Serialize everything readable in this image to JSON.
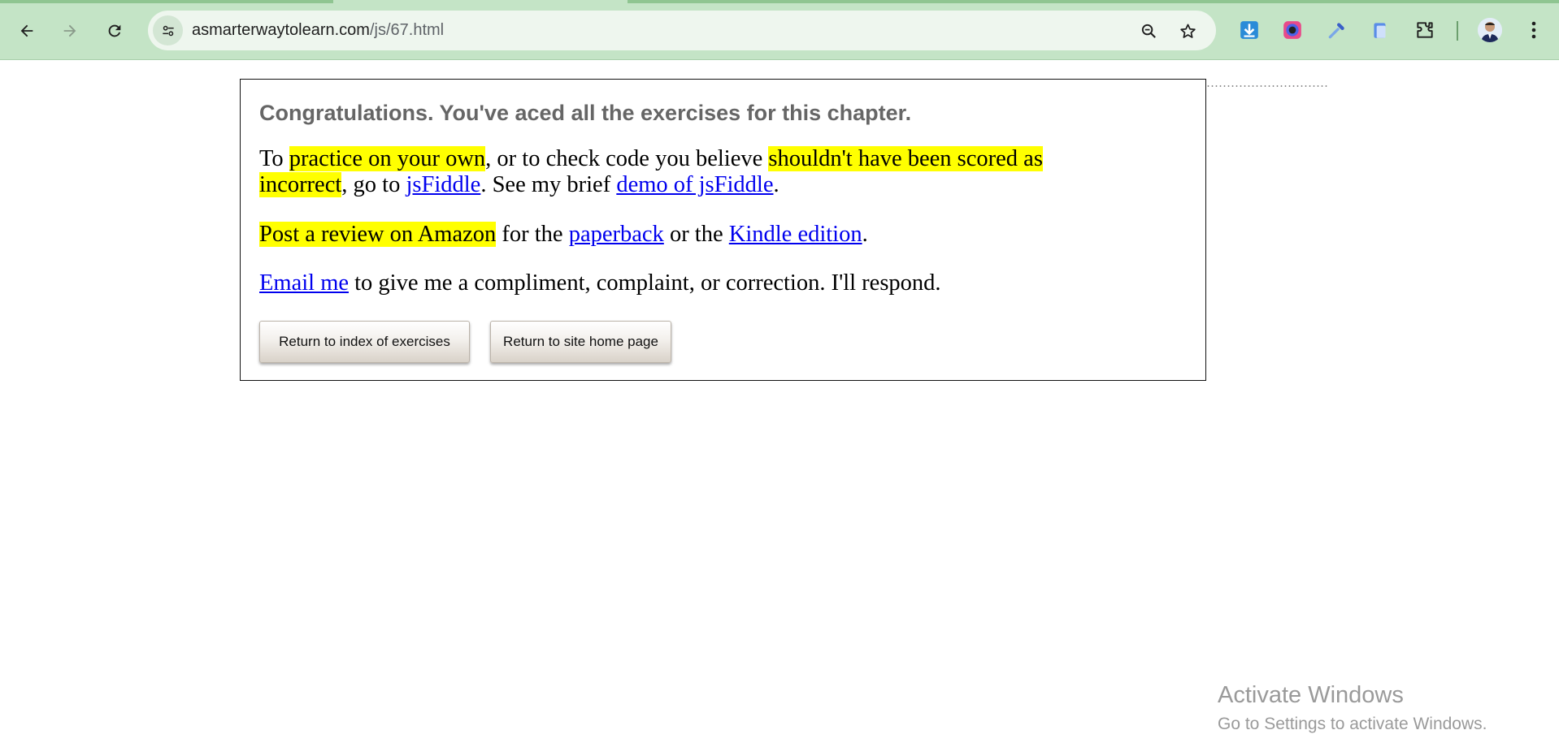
{
  "browser": {
    "url_domain": "asmarterwaytolearn.com",
    "url_path": "/js/67.html",
    "accent_color": "#c4e4c6",
    "nav_icons": [
      "back-arrow-icon",
      "forward-arrow-icon",
      "reload-icon"
    ],
    "omnibox_icons": [
      "site-info-icon",
      "zoom-icon",
      "bookmark-star-icon"
    ],
    "extension_icons": [
      "download-extension-icon",
      "color-picker-extension-icon",
      "eyedropper-extension-icon",
      "clipboard-extension-icon",
      "puzzle-extensions-icon"
    ],
    "menu_icon": "more-vertical-icon"
  },
  "page": {
    "heading": "Congratulations. You've aced all the exercises for this chapter.",
    "p1": {
      "t1": "To ",
      "h1": "practice on your own",
      "t2": ", or to check code you believe ",
      "h2": "shouldn't have been scored as",
      "h3": "incorrect",
      "t3": ", go to ",
      "link1": "jsFiddle",
      "t4": ". See my brief ",
      "link2": "demo of jsFiddle",
      "t5": "."
    },
    "p2": {
      "h1": "Post a review on Amazon",
      "t1": " for the ",
      "link1": "paperback",
      "t2": " or the ",
      "link2": "Kindle edition",
      "t3": "."
    },
    "p3": {
      "link1": "Email me",
      "t1": " to give me a compliment, complaint, or correction. I'll respond."
    },
    "buttons": {
      "index": "Return to index of exercises",
      "home": "Return to site home page"
    },
    "highlight_color": "#ffff00",
    "link_color": "#0000ee"
  },
  "watermark": {
    "line1": "Activate Windows",
    "line2": "Go to Settings to activate Windows."
  }
}
